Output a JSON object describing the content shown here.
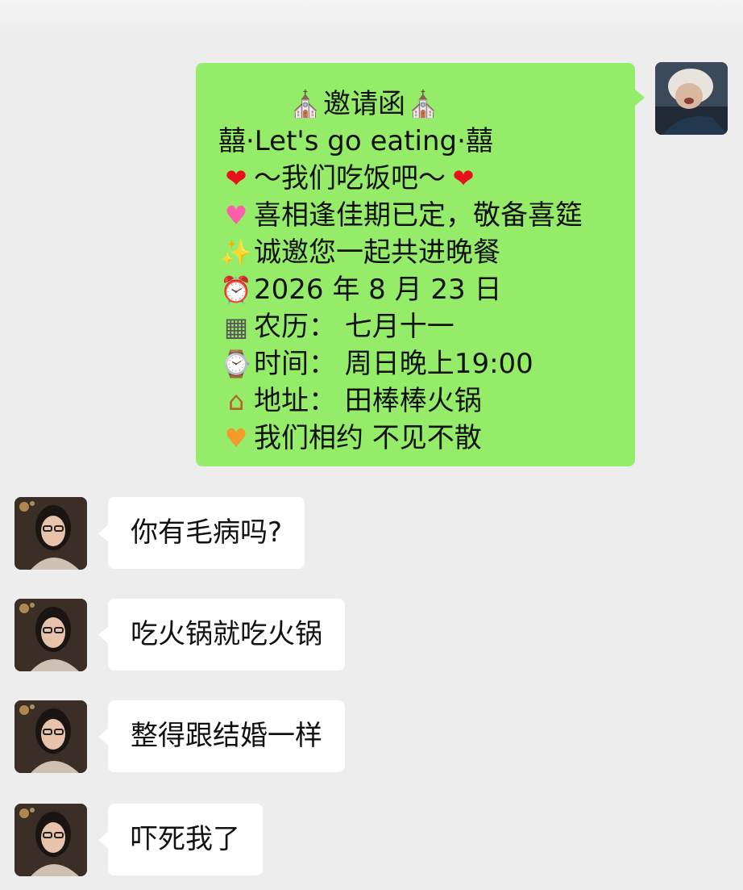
{
  "chat": {
    "invite_message": {
      "lines": [
        {
          "emoji_left": "⛪",
          "text": "邀请函",
          "emoji_right": "⛪"
        },
        {
          "prefix": "囍",
          "text": "·Let's go eating·",
          "suffix": "囍"
        },
        {
          "emoji_left": "❤",
          "text": "～我们吃饭吧～",
          "emoji_right": "❤"
        },
        {
          "emoji_left": "💗",
          "text": "喜相逢佳期已定，敬备喜筵"
        },
        {
          "emoji_left": "✨",
          "text": "诚邀您一起共进晚餐"
        },
        {
          "emoji_left": "⏰",
          "text": "2026 年 8 月 23 日"
        },
        {
          "emoji_left": "📅",
          "text": "农历：  七月十一"
        },
        {
          "emoji_left": "⌚",
          "text": "时间：  周日晚上19:00"
        },
        {
          "emoji_left": "🏠",
          "text": "地址：  田棒棒火锅"
        },
        {
          "emoji_left": "💑",
          "text": "我们相约 不见不散"
        }
      ]
    },
    "replies": [
      "你有毛病吗?",
      "吃火锅就吃火锅",
      "整得跟结婚一样",
      "吓死我了"
    ]
  },
  "colors": {
    "self_bubble": "#95ec69",
    "friend_bubble": "#ffffff",
    "background": "#ededed"
  },
  "icons": [
    "self-avatar",
    "friend-avatar",
    "chapel-icon",
    "heart-icon",
    "sparkling-heart-icon",
    "sparkles-icon",
    "alarm-clock-icon",
    "calendar-icon",
    "watch-icon",
    "house-icon",
    "couple-icon"
  ]
}
